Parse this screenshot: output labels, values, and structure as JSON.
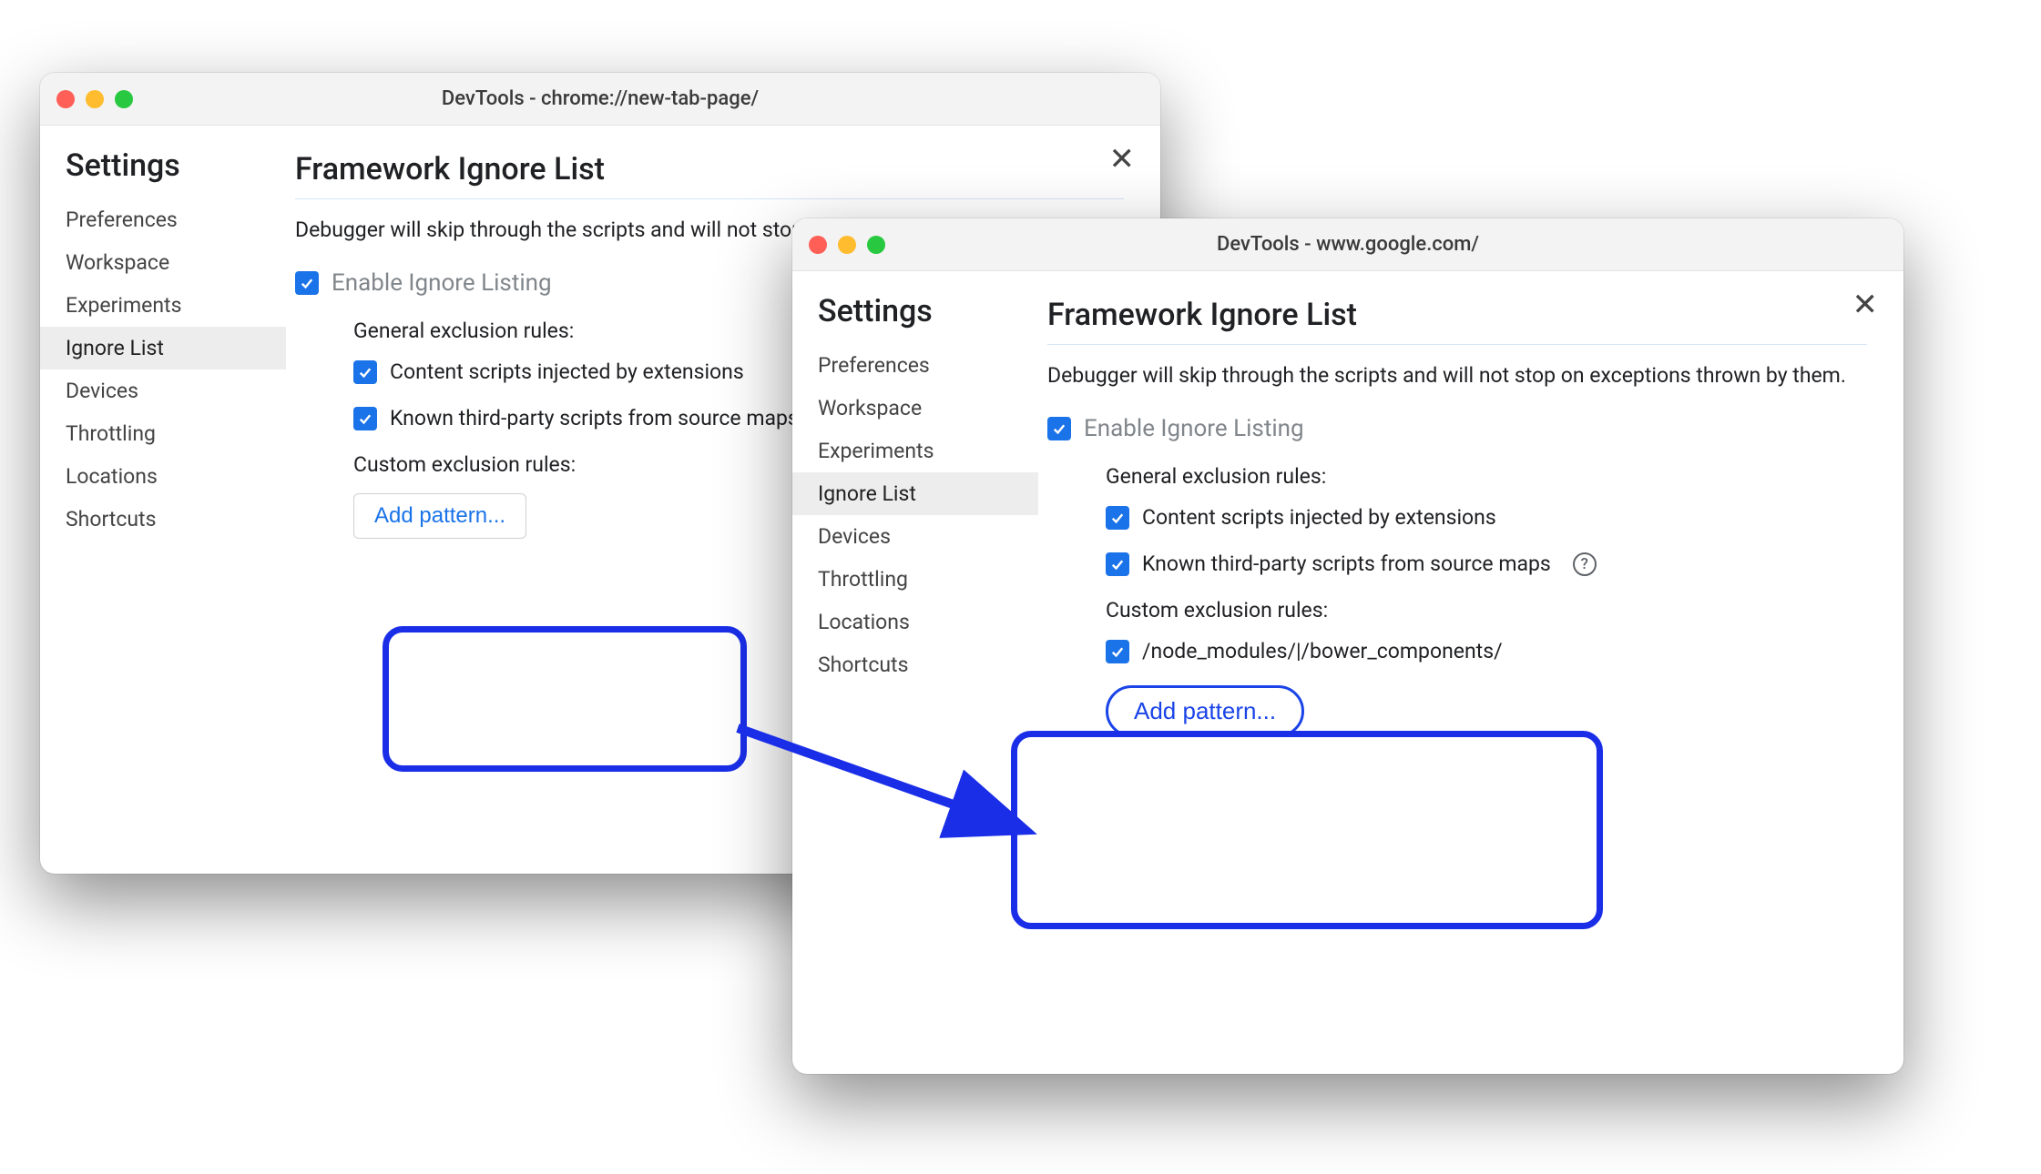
{
  "windows": {
    "back": {
      "title": "DevTools - chrome://new-tab-page/",
      "settings_heading": "Settings",
      "sidebar": [
        "Preferences",
        "Workspace",
        "Experiments",
        "Ignore List",
        "Devices",
        "Throttling",
        "Locations",
        "Shortcuts"
      ],
      "selected_index": 3,
      "main": {
        "title": "Framework Ignore List",
        "description": "Debugger will skip through the scripts and will not stop on exceptions thrown by them.",
        "enable_label": "Enable Ignore Listing",
        "general_rules_heading": "General exclusion rules:",
        "rule_content_scripts": "Content scripts injected by extensions",
        "rule_known_third_party": "Known third-party scripts from source maps",
        "custom_rules_heading": "Custom exclusion rules:",
        "add_pattern_label": "Add pattern..."
      }
    },
    "front": {
      "title": "DevTools - www.google.com/",
      "settings_heading": "Settings",
      "sidebar": [
        "Preferences",
        "Workspace",
        "Experiments",
        "Ignore List",
        "Devices",
        "Throttling",
        "Locations",
        "Shortcuts"
      ],
      "selected_index": 3,
      "main": {
        "title": "Framework Ignore List",
        "description": "Debugger will skip through the scripts and will not stop on exceptions thrown by them.",
        "enable_label": "Enable Ignore Listing",
        "general_rules_heading": "General exclusion rules:",
        "rule_content_scripts": "Content scripts injected by extensions",
        "rule_known_third_party": "Known third-party scripts from source maps",
        "custom_rules_heading": "Custom exclusion rules:",
        "custom_patterns": [
          "/node_modules/|/bower_components/"
        ],
        "add_pattern_label": "Add pattern..."
      }
    }
  },
  "help_tooltip_char": "?"
}
